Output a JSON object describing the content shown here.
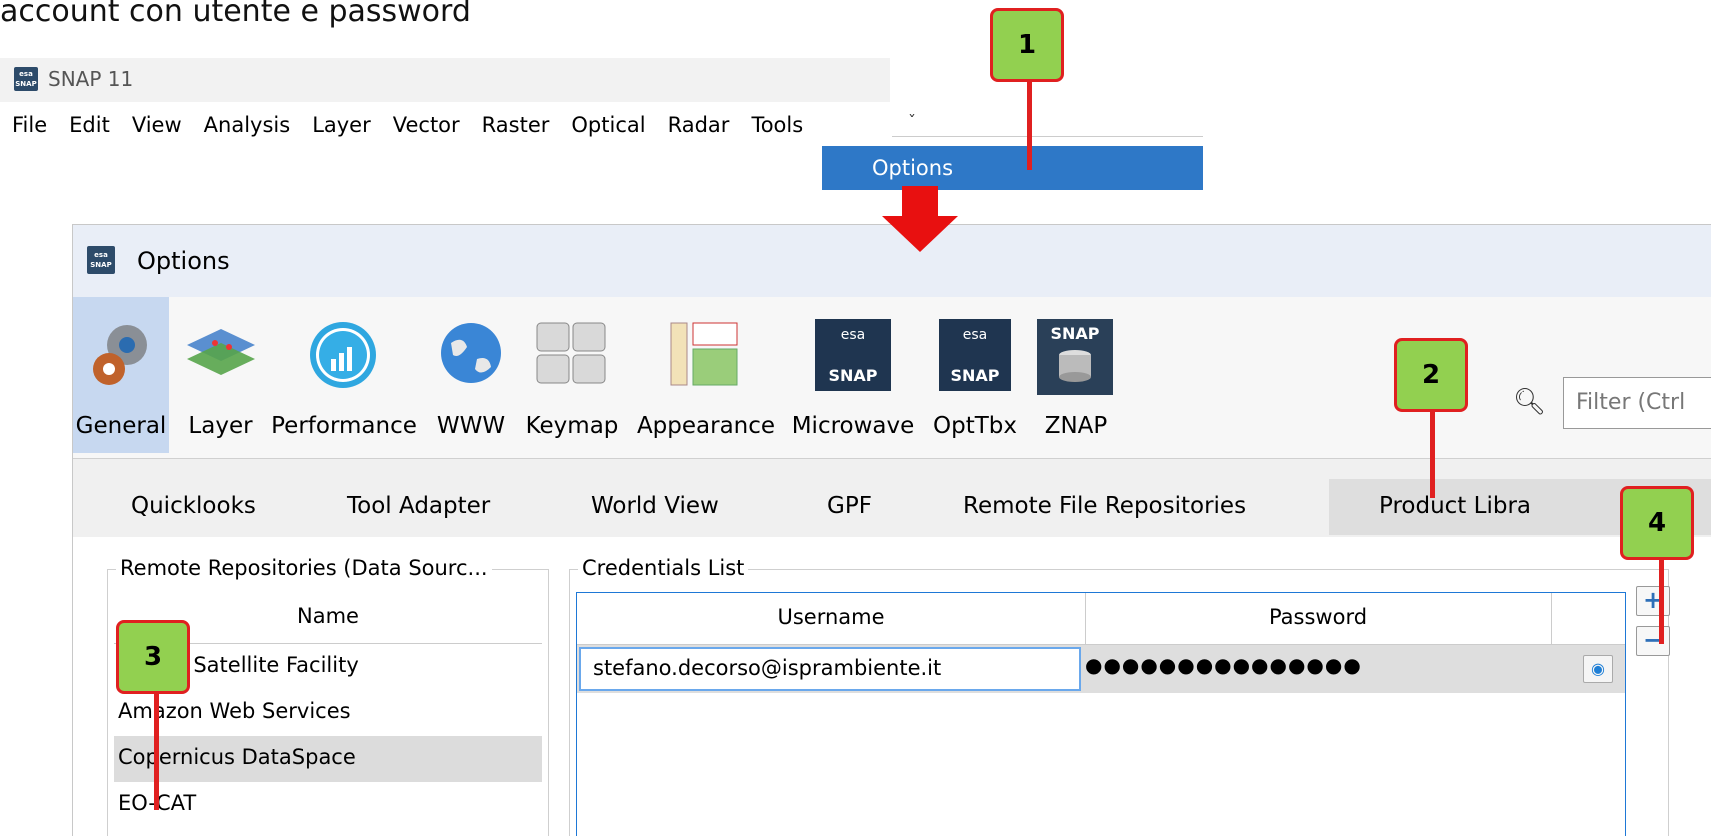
{
  "heading": "account con utente e password",
  "main_window": {
    "logo_text": "esa SNAP",
    "title": "SNAP 11",
    "menus": [
      "File",
      "Edit",
      "View",
      "Analysis",
      "Layer",
      "Vector",
      "Raster",
      "Optical",
      "Radar",
      "Tools"
    ],
    "open_menu_item": "Options"
  },
  "options_dialog": {
    "title": "Options",
    "categories": [
      {
        "label": "General",
        "icon": "gears-icon",
        "selected": true
      },
      {
        "label": "Layer",
        "icon": "layers-icon"
      },
      {
        "label": "Performance",
        "icon": "performance-chart-icon"
      },
      {
        "label": "WWW",
        "icon": "globe-icon"
      },
      {
        "label": "Keymap",
        "icon": "keyboard-icon"
      },
      {
        "label": "Appearance",
        "icon": "appearance-icon"
      },
      {
        "label": "Microwave",
        "icon": "esa-microwave-snap-icon"
      },
      {
        "label": "OptTbx",
        "icon": "esa-optical-snap-icon"
      },
      {
        "label": "ZNAP",
        "icon": "znap-database-icon"
      }
    ],
    "search_placeholder": "Filter (Ctrl",
    "tabs": [
      "Quicklooks",
      "Tool Adapter",
      "World View",
      "GPF",
      "Remote File Repositories",
      "Product Libra"
    ],
    "active_tab": "Product Libra",
    "repositories": {
      "legend": "Remote Repositories (Data Sourc...",
      "column": "Name",
      "rows": [
        "Alaska Satellite Facility",
        "Amazon Web Services",
        "Copernicus DataSpace",
        "EO-CAT"
      ],
      "selected": "Copernicus DataSpace"
    },
    "credentials": {
      "legend": "Credentials List",
      "columns": [
        "Username",
        "Password"
      ],
      "rows": [
        {
          "username": "stefano.decorso@isprambiente.it",
          "password": "●●●●●●●●●●●●●●●"
        }
      ],
      "add_button": "+",
      "remove_button": "−",
      "show_password_icon": "eye-icon"
    }
  },
  "annotations": [
    "1",
    "2",
    "3",
    "4"
  ],
  "colors": {
    "badge": "#92d050",
    "badge_border": "#e02020",
    "menu_highlight": "#2e78c7",
    "selected_category": "#c7d8f0"
  }
}
